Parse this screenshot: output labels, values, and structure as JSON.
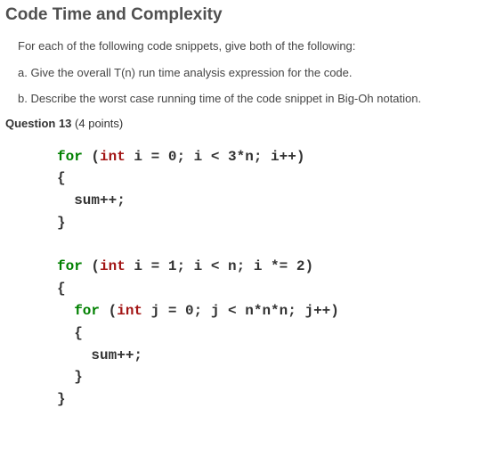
{
  "section_title": "Code Time and Complexity",
  "instructions": {
    "intro": "For each of the following code snippets, give both of the following:",
    "a": "a. Give the overall T(n) run time analysis expression for the code.",
    "b": "b. Describe the worst case running time of the code snippet in Big-Oh notation."
  },
  "question": {
    "label": "Question 13",
    "points": "(4 points)"
  },
  "code": {
    "l1_kw1": "for",
    "l1_rest1": " (",
    "l1_typ": "int",
    "l1_rest2": " i = 0; i < 3*n; i++)",
    "l2": "{",
    "l3": "  sum++;",
    "l4": "}",
    "blank1": "",
    "l5_kw1": "for",
    "l5_rest1": " (",
    "l5_typ": "int",
    "l5_rest2": " i = 1; i < n; i *= 2)",
    "l6": "{",
    "l7_pre": "  ",
    "l7_kw1": "for",
    "l7_rest1": " (",
    "l7_typ": "int",
    "l7_rest2": " j = 0; j < n*n*n; j++)",
    "l8": "  {",
    "l9": "    sum++;",
    "l10": "  }",
    "l11": "}"
  }
}
